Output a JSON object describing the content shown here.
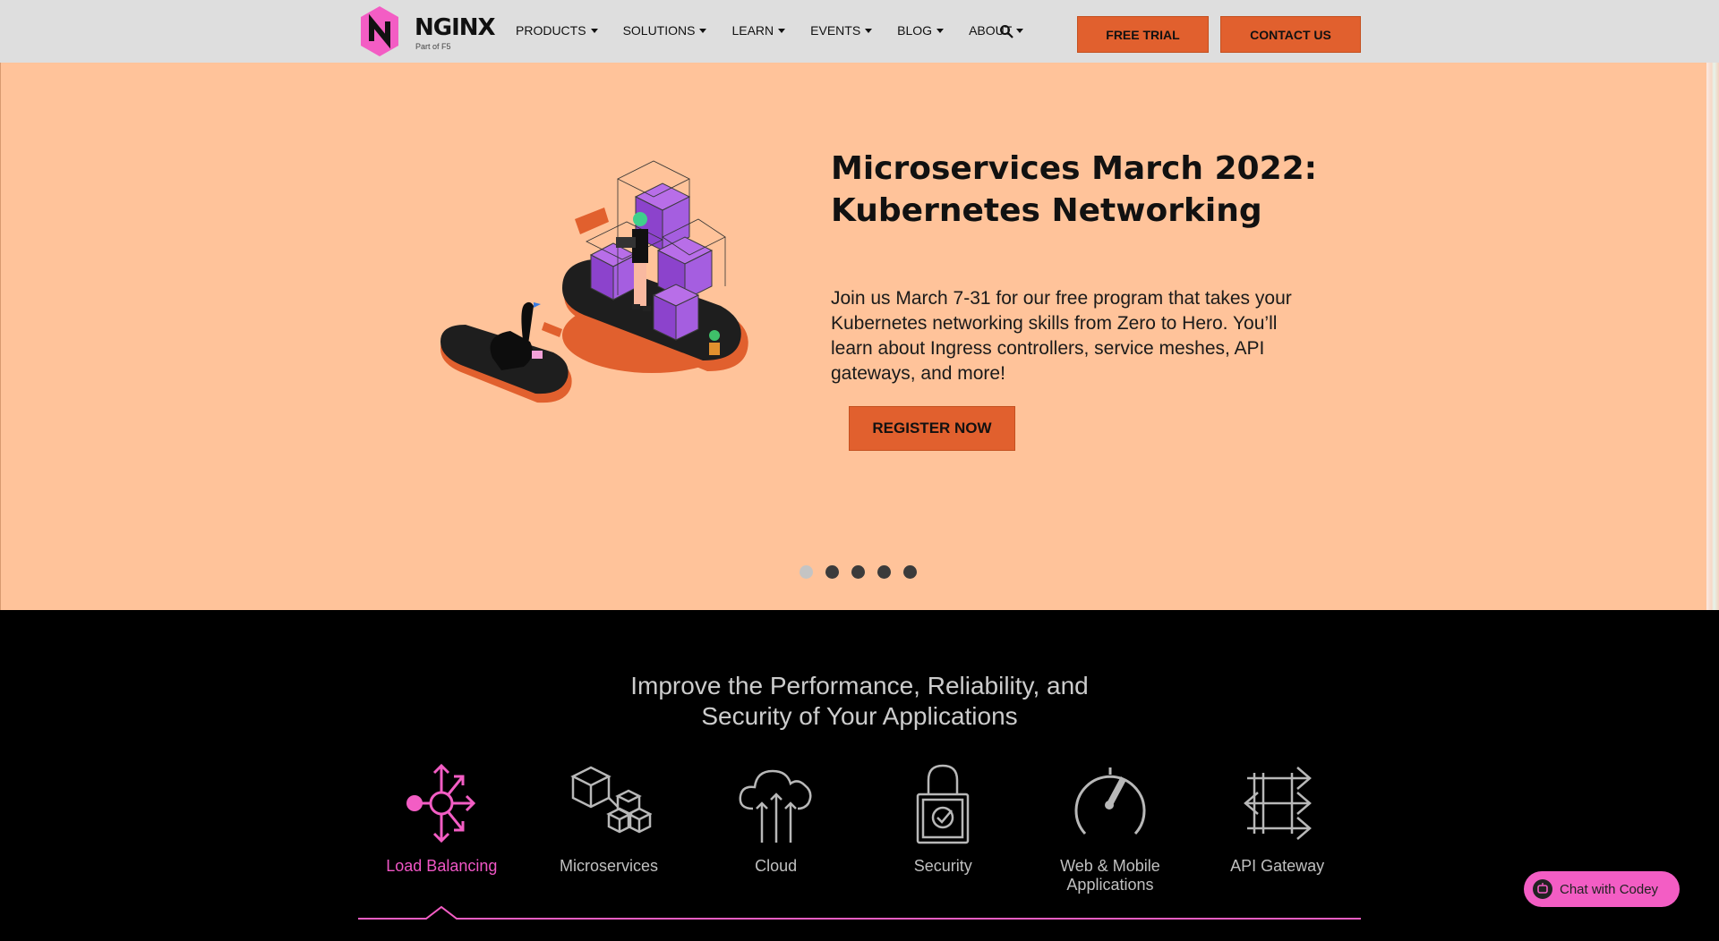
{
  "brand": {
    "name": "NGINX",
    "subtitle": "Part of F5",
    "color": "#f35dc4"
  },
  "nav": {
    "menu": [
      {
        "label": "PRODUCTS"
      },
      {
        "label": "SOLUTIONS"
      },
      {
        "label": "LEARN"
      },
      {
        "label": "EVENTS"
      },
      {
        "label": "BLOG"
      },
      {
        "label": "ABOUT"
      }
    ],
    "search_icon": "search-icon",
    "free_trial": "FREE TRIAL",
    "contact_us": "CONTACT US"
  },
  "hero": {
    "title_line1": "Microservices March 2022:",
    "title_line2": "Kubernetes Networking",
    "description": "Join us March 7-31 for our free program that takes your Kubernetes networking skills from Zero to Hero. You’ll learn about Ingress controllers, service meshes, API gateways, and more!",
    "cta": "REGISTER NOW",
    "slides_total": 5,
    "active_slide": 1,
    "background": "#ffc39a",
    "accent": "#e1602e"
  },
  "features": {
    "title_line1": "Improve the Performance, Reliability, and",
    "title_line2": "Security of Your Applications",
    "items": [
      {
        "label": "Load Balancing",
        "icon": "load-balancing-icon",
        "active": true
      },
      {
        "label": "Microservices",
        "icon": "microservices-icon",
        "active": false
      },
      {
        "label": "Cloud",
        "icon": "cloud-icon",
        "active": false
      },
      {
        "label": "Security",
        "icon": "lock-icon",
        "active": false
      },
      {
        "label_line1": "Web & Mobile",
        "label_line2": "Applications",
        "icon": "gauge-icon",
        "active": false
      },
      {
        "label": "API Gateway",
        "icon": "api-gateway-icon",
        "active": false
      }
    ]
  },
  "chat": {
    "label": "Chat with Codey"
  }
}
